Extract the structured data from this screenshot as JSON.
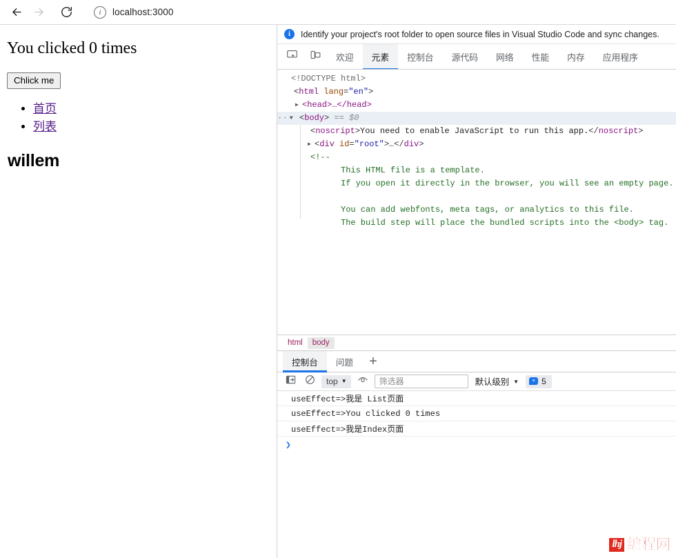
{
  "browser": {
    "back_icon": "arrow-left-icon",
    "forward_icon": "arrow-right-icon",
    "reload_icon": "reload-icon",
    "site_info_icon": "info-icon",
    "site_info_glyph": "i",
    "url": "localhost:3000"
  },
  "page": {
    "heading": "You clicked 0 times",
    "button_label": "Chlick me",
    "links": [
      {
        "label": "首页"
      },
      {
        "label": "列表"
      }
    ],
    "subheading": "willem",
    "link_color": "#551a8b"
  },
  "devtools": {
    "infobar": {
      "icon": "info-icon",
      "icon_glyph": "i",
      "message": "Identify your project's root folder to open source files in Visual Studio Code and sync changes.",
      "accent": "#1a73e8"
    },
    "toolbar_icons": [
      {
        "name": "inspect-element-icon"
      },
      {
        "name": "device-toolbar-icon"
      }
    ],
    "panel_tabs": [
      {
        "label": "欢迎",
        "active": false
      },
      {
        "label": "元素",
        "active": true
      },
      {
        "label": "控制台",
        "active": false
      },
      {
        "label": "源代码",
        "active": false
      },
      {
        "label": "网络",
        "active": false
      },
      {
        "label": "性能",
        "active": false
      },
      {
        "label": "内存",
        "active": false
      },
      {
        "label": "应用程序",
        "active": false
      }
    ],
    "active_tab_accent": "#1a73e8",
    "elements": {
      "doctype": "<!DOCTYPE html>",
      "html_open_tag": "html",
      "html_attr_name": "lang",
      "html_attr_value": "\"en\"",
      "head_collapsed": "<head>…</head>",
      "body_tag": "body",
      "body_selected_marker": "== $0",
      "noscript_line": "<noscript>You need to enable JavaScript to run this app.</noscript>",
      "noscript_tag_open": "noscript",
      "noscript_text": "You need to enable JavaScript to run this app.",
      "div_tag": "div",
      "div_attr_name": "id",
      "div_attr_value": "\"root\"",
      "div_collapsed": "…",
      "comment_open": "<!--",
      "comment_lines": [
        "This HTML file is a template.",
        "If you open it directly in the browser, you will see an empty page.",
        "",
        "You can add webfonts, meta tags, or analytics to this file.",
        "The build step will place the bundled scripts into the <body> tag."
      ]
    },
    "breadcrumb": [
      {
        "label": "html",
        "active": false
      },
      {
        "label": "body",
        "active": true
      }
    ],
    "drawer_tabs": [
      {
        "label": "控制台",
        "active": true
      },
      {
        "label": "问题",
        "active": false
      }
    ],
    "drawer_add_label": "+",
    "console_toolbar": {
      "sidebar_icon": "console-sidebar-icon",
      "clear_icon": "clear-console-icon",
      "context": "top",
      "context_caret": "▼",
      "eye_icon": "live-expression-icon",
      "filter_placeholder": "筛选器",
      "filter_value": "",
      "level_label": "默认级别",
      "level_caret": "▼",
      "message_count": "5",
      "badge_icon": "message-bubble-icon"
    },
    "console_messages": [
      {
        "text": "useEffect=>我是 List页面"
      },
      {
        "text": "useEffect=>You clicked 0 times"
      },
      {
        "text": "useEffect=>我是Index页面"
      }
    ],
    "console_prompt_glyph": "❯"
  },
  "watermark": {
    "badge": "lhj",
    "text": "编程网",
    "color": "#e02b20"
  }
}
